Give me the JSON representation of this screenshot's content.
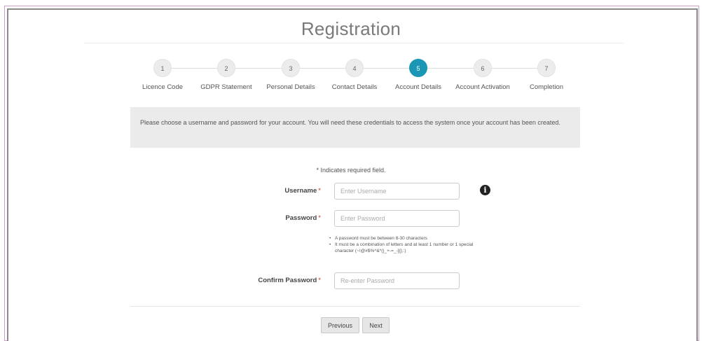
{
  "title": "Registration",
  "steps": [
    {
      "number": "1",
      "label": "Licence Code"
    },
    {
      "number": "2",
      "label": "GDPR Statement"
    },
    {
      "number": "3",
      "label": "Personal Details"
    },
    {
      "number": "4",
      "label": "Contact Details"
    },
    {
      "number": "5",
      "label": "Account Details",
      "active": true
    },
    {
      "number": "6",
      "label": "Account Activation"
    },
    {
      "number": "7",
      "label": "Completion"
    }
  ],
  "info_text": "Please choose a username and password for your account. You will need these credentials to access the system once your account has been created.",
  "required_note": "* Indicates required field.",
  "required_marker": "*",
  "form": {
    "username": {
      "label": "Username",
      "placeholder": "Enter Username",
      "value": ""
    },
    "password": {
      "label": "Password",
      "placeholder": "Enter Password",
      "value": ""
    },
    "confirm_password": {
      "label": "Confirm Password",
      "placeholder": "Re-enter Password",
      "value": ""
    }
  },
  "password_rules": [
    "A password must be between 8-30 characters",
    "It must be a combination of letters and at least 1 number or 1 special character (~!@#$%^&*()_+-=_-]{};:)"
  ],
  "buttons": {
    "previous": "Previous",
    "next": "Next"
  },
  "colors": {
    "active_step": "#1b97b5",
    "info_box": "#ebebeb",
    "frame_border": "#c9a2c6"
  }
}
